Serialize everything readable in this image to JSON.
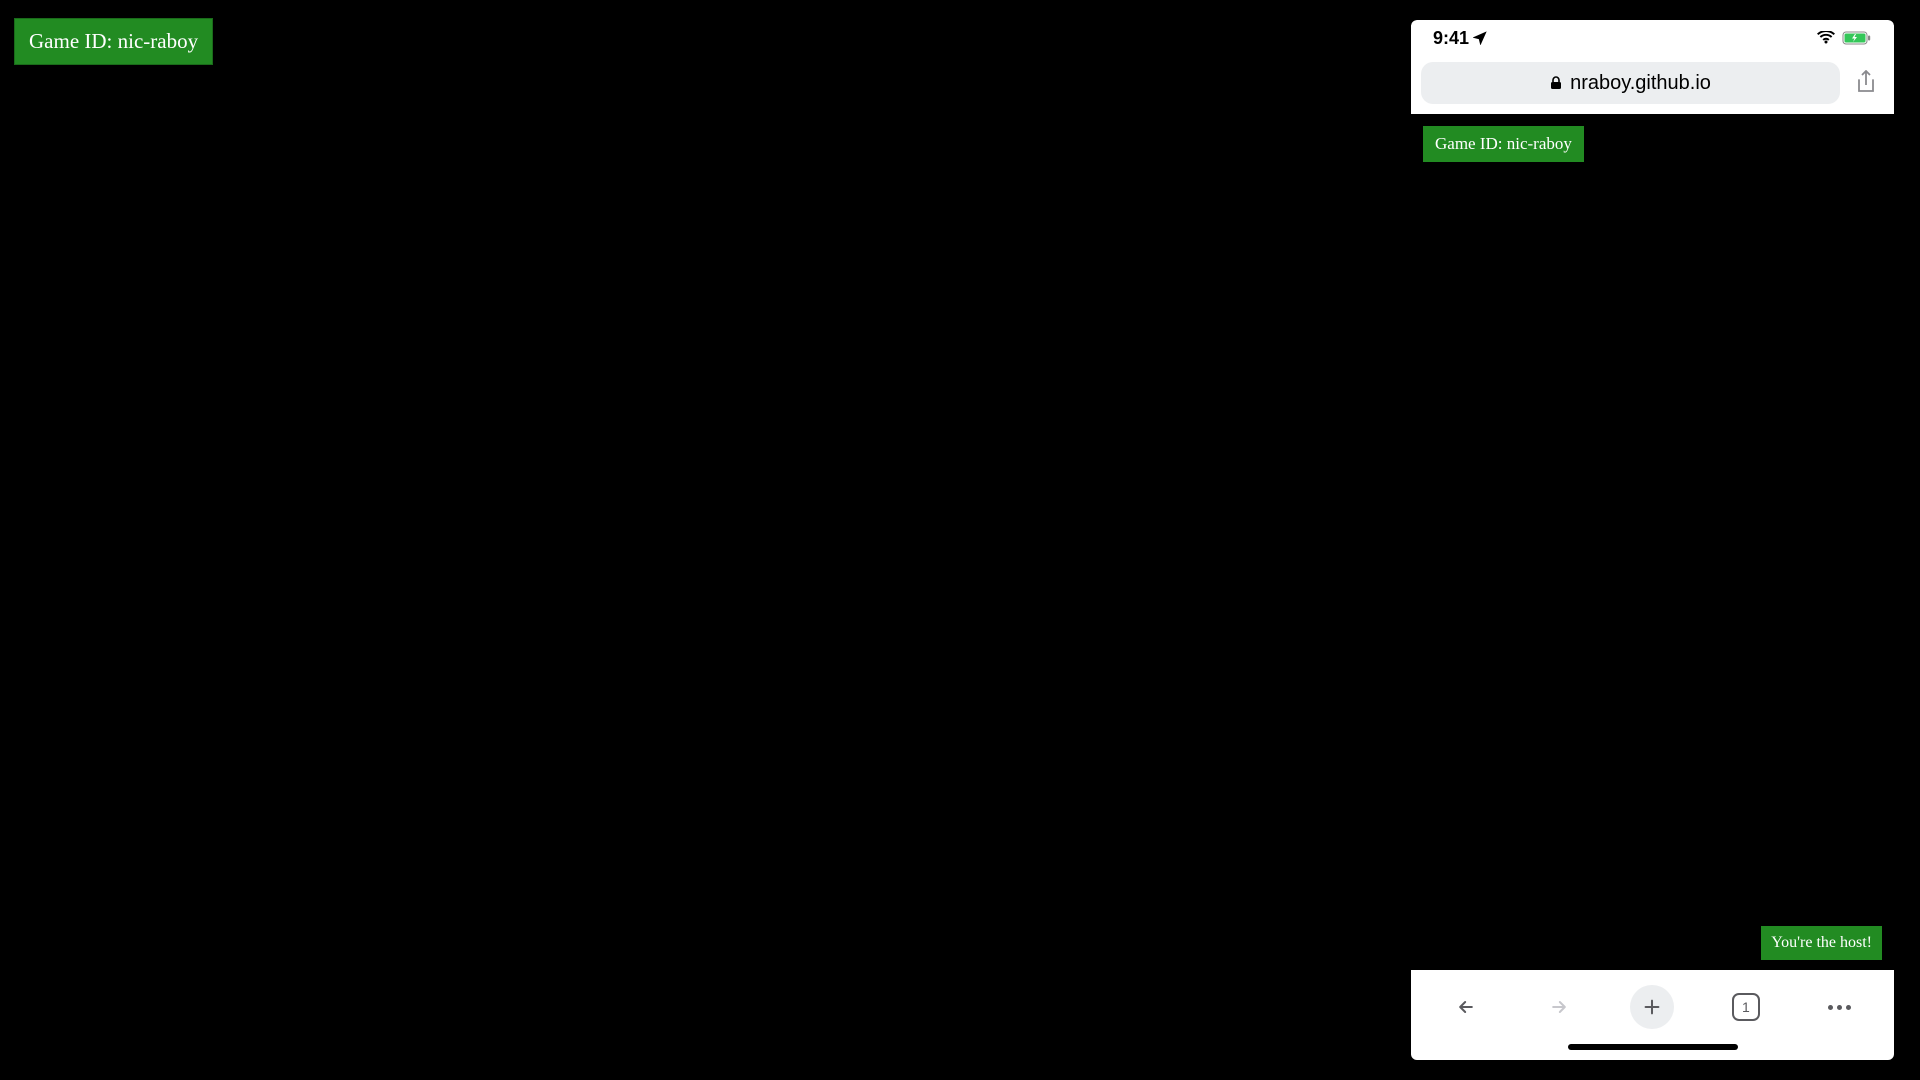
{
  "desktop": {
    "game_id_label": "Game ID: nic-raboy"
  },
  "phone": {
    "status": {
      "time": "9:41"
    },
    "address": {
      "url": "nraboy.github.io"
    },
    "content": {
      "game_id_label": "Game ID: nic-raboy",
      "host_label": "You're the host!"
    },
    "nav": {
      "tab_count": "1"
    }
  }
}
